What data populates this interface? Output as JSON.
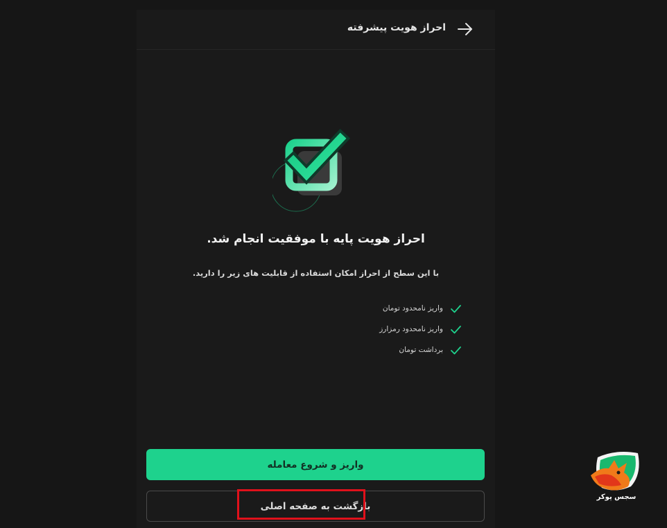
{
  "header": {
    "title": "احراز هویت پیشرفته",
    "back_icon": "arrow-right-icon"
  },
  "hero": {
    "icon": "checkbox-success-icon",
    "accent_color": "#1ed28d"
  },
  "success": {
    "title": "احراز هویت پایه با موفقیت انجام شد.",
    "description": "با این سطح از احراز امکان استفاده از قابلیت های زیر را دارید."
  },
  "features": [
    {
      "label": "واریز نامحدود تومان",
      "icon": "check-icon"
    },
    {
      "label": "واریز نامحدود رمزارز",
      "icon": "check-icon"
    },
    {
      "label": "برداشت تومان",
      "icon": "check-icon"
    }
  ],
  "actions": {
    "primary_label": "واریز و شروع معامله",
    "secondary_label": "بازگشت به صفحه اصلی"
  },
  "watermark": {
    "text": "سجس پوکر",
    "icon": "dog-logo-icon"
  },
  "colors": {
    "background": "#161616",
    "panel": "#1a1a1a",
    "accent": "#1ed28d",
    "highlight": "#e0111b"
  }
}
